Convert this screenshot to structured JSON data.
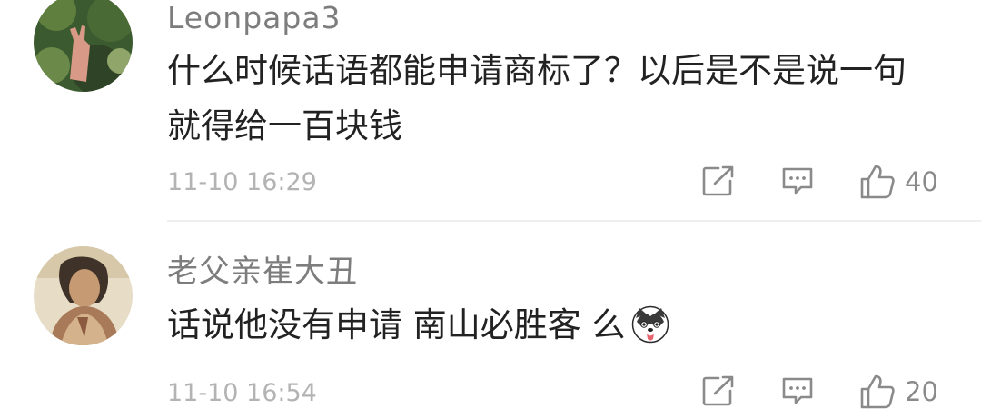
{
  "comments": [
    {
      "username": "Leonpapa3",
      "content": "什么时候话语都能申请商标了？以后是不是说一句就得给一百块钱",
      "timestamp": "11-10 16:29",
      "likes": "40"
    },
    {
      "username": "老父亲崔大丑",
      "content": "话说他没有申请 南山必胜客 么",
      "timestamp": "11-10 16:54",
      "likes": "20"
    }
  ],
  "colors": {
    "username": "#7d7d7d",
    "text": "#222222",
    "meta": "#b3b3b3",
    "icon": "#8a8a8a",
    "divider": "#efefef"
  },
  "icons": {
    "share": "share-icon",
    "reply": "reply-icon",
    "like": "thumbs-up-icon",
    "emoji": "husky-dog-emoji-icon"
  }
}
